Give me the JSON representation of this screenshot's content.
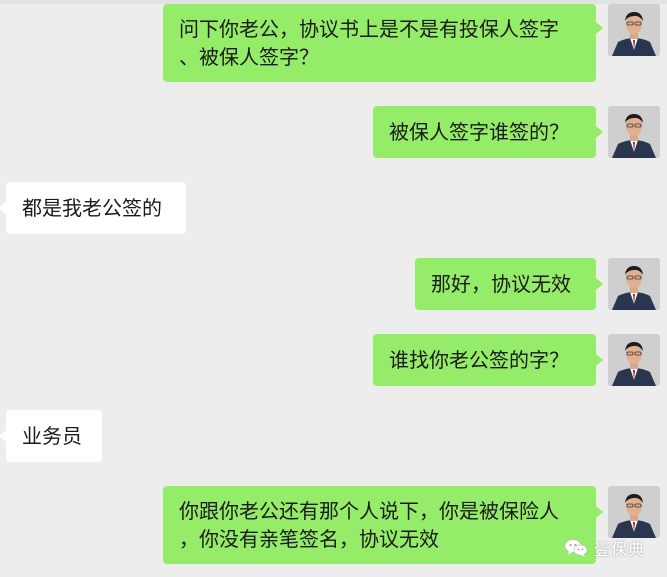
{
  "chat": {
    "messages": [
      {
        "side": "right",
        "line1": "问下你老公，协议书上是不是有投保人签字",
        "line2": "、被保人签字？"
      },
      {
        "side": "right",
        "line1": "被保人签字谁签的？"
      },
      {
        "side": "left",
        "line1": "都是我老公签的"
      },
      {
        "side": "right",
        "line1": "那好，协议无效"
      },
      {
        "side": "right",
        "line1": "谁找你老公签的字？"
      },
      {
        "side": "left",
        "line1": "业务员"
      },
      {
        "side": "right",
        "line1": "你跟你老公还有那个人说下，你是被保险人",
        "line2": "，你没有亲笔签名，协议无效"
      }
    ]
  },
  "watermark": {
    "icon": "wechat-icon",
    "text": "壹保典"
  },
  "colors": {
    "background": "#ededed",
    "right_bubble": "#95ec69",
    "left_bubble": "#ffffff"
  }
}
